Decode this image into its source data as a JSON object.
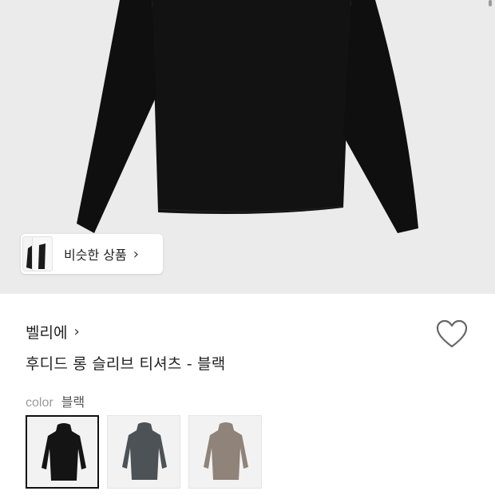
{
  "similar_products": {
    "label": "비슷한 상품",
    "chevron": "›"
  },
  "product": {
    "brand": "벨리에",
    "brand_chevron": "›",
    "title": "후디드 롱 슬리브 티셔츠 - 블랙",
    "wishlist_icon": "heart-outline-icon"
  },
  "color": {
    "label": "color",
    "selected": "블랙",
    "options": [
      {
        "name": "블랙",
        "hex": "#141414",
        "selected": true
      },
      {
        "name": "차콜",
        "hex": "#4c5256",
        "selected": false
      },
      {
        "name": "베이지",
        "hex": "#8f837a",
        "selected": false
      }
    ]
  },
  "colors": {
    "hero_background": "#ebebeb",
    "garment": "#121212"
  }
}
